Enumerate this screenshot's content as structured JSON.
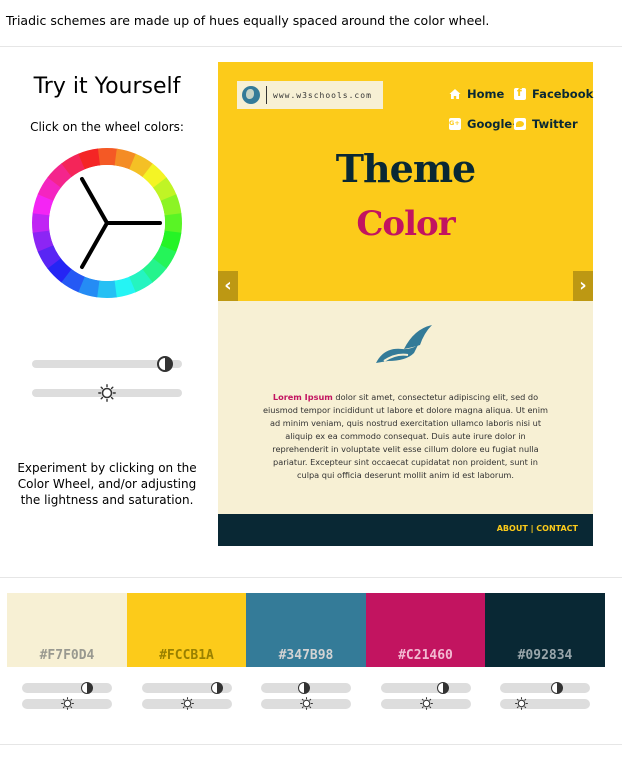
{
  "intro": "Triadic schemes are made up of hues equally spaced around the color wheel.",
  "try": {
    "title": "Try it Yourself",
    "subtitle": "Click on the wheel colors:",
    "lightness_level": 0.93,
    "saturation_level": 0.5,
    "experiment": "Experiment by clicking on the Color Wheel, and/or adjusting the lightness and saturation."
  },
  "preview": {
    "url": "www.w3schools.com",
    "nav": {
      "home": "Home",
      "facebook": "Facebook",
      "google": "Google+",
      "twitter": "Twitter"
    },
    "line1": "Theme",
    "line2": "Color",
    "prev": "‹",
    "next": "›",
    "lorem_lead": "Lorem Ipsum",
    "lorem_body": " dolor sit amet, consectetur adipiscing elit, sed do eiusmod tempor incididunt ut labore et dolore magna aliqua. Ut enim ad minim veniam, quis nostrud exercitation ullamco laboris nisi ut aliquip ex ea commodo consequat. Duis aute irure dolor in reprehenderit in voluptate velit esse cillum dolore eu fugiat nulla pariatur. Excepteur sint occaecat cupidatat non proident, sunt in culpa qui officia deserunt mollit anim id est laborum.",
    "footer": "ABOUT | CONTACT"
  },
  "swatches": [
    {
      "hex": "#F7F0D4",
      "text": "#999990",
      "lightness_level": 0.75,
      "saturation_level": 0.5
    },
    {
      "hex": "#FCCB1A",
      "text": "#998000",
      "lightness_level": 0.89,
      "saturation_level": 0.5
    },
    {
      "hex": "#347B98",
      "text": "#D3D3D3",
      "lightness_level": 0.48,
      "saturation_level": 0.5
    },
    {
      "hex": "#C21460",
      "text": "#F2BAD2",
      "lightness_level": 0.72,
      "saturation_level": 0.5
    },
    {
      "hex": "#092834",
      "text": "#9AA6AB",
      "lightness_level": 0.65,
      "saturation_level": 0.2
    }
  ]
}
